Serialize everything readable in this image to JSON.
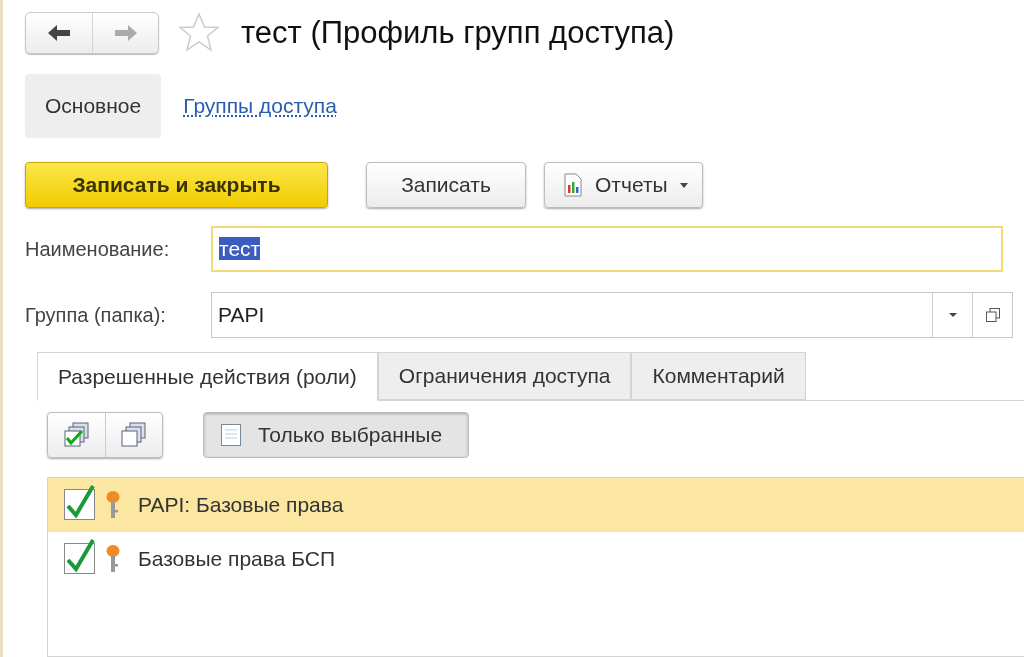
{
  "window": {
    "title": "тест (Профиль групп доступа)",
    "favorite": false
  },
  "sections": [
    {
      "label": "Основное",
      "selected": true
    },
    {
      "label": "Группы доступа",
      "selected": false
    }
  ],
  "commands": [
    {
      "label": "Записать и закрыть",
      "kind": "default"
    },
    {
      "label": "Записать",
      "kind": "plain"
    },
    {
      "label": "Отчеты",
      "kind": "menu"
    }
  ],
  "fields": [
    {
      "label": "Наименование:",
      "value": "тест",
      "kind": "text",
      "text_selected": true
    },
    {
      "label": "Группа (папка):",
      "value": "PAPI",
      "kind": "choice",
      "text_selected": false
    }
  ],
  "tabs": [
    {
      "label": "Разрешенные действия (роли)",
      "selected": true
    },
    {
      "label": "Ограничения доступа",
      "selected": false
    },
    {
      "label": "Комментарий",
      "selected": false
    }
  ],
  "toolbar": {
    "only_selected": {
      "label": "Только выбранные",
      "pressed": true
    }
  },
  "roles": [
    {
      "name": "PAPI: Базовые права",
      "checked": true,
      "selected": true
    },
    {
      "name": "Базовые права БСП",
      "checked": true,
      "selected": false
    }
  ]
}
